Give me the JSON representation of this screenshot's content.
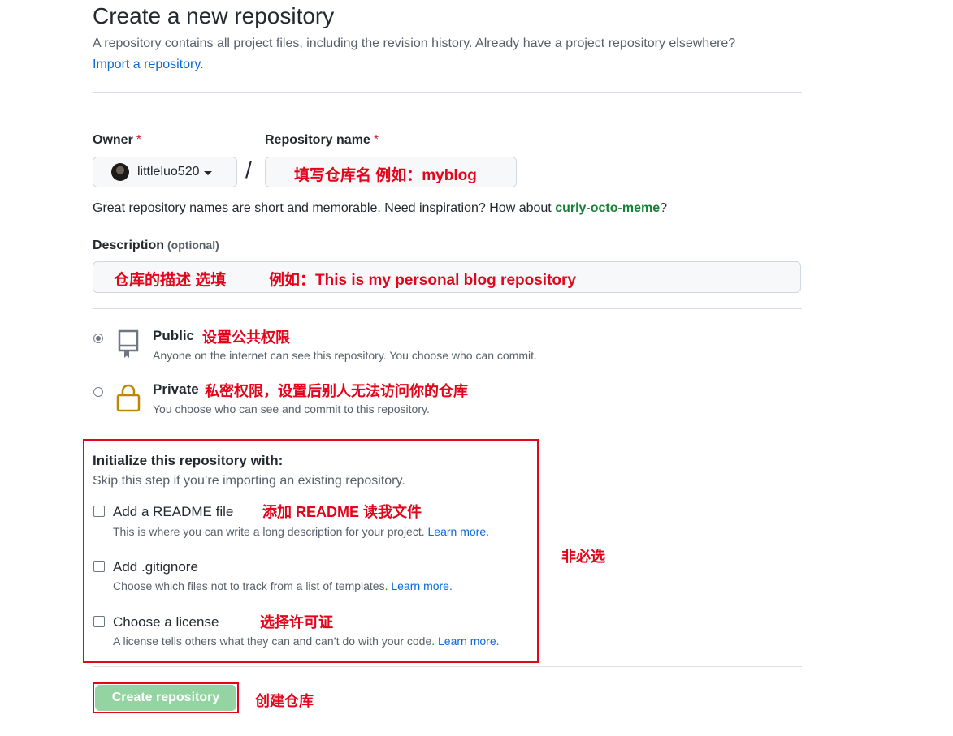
{
  "header": {
    "title": "Create a new repository",
    "subtitle": "A repository contains all project files, including the revision history. Already have a project repository elsewhere?",
    "import_link": "Import a repository."
  },
  "owner": {
    "label": "Owner",
    "required_mark": "*",
    "value": "littleluo520"
  },
  "repo_name": {
    "label": "Repository name",
    "required_mark": "*",
    "slash": "/",
    "annotation": "填写仓库名   例如：myblog"
  },
  "name_hint": {
    "text": "Great repository names are short and memorable. Need inspiration? How about ",
    "suggestion": "curly-octo-meme",
    "end": "?"
  },
  "description": {
    "label": "Description",
    "optional": "(optional)",
    "annotation_left": "仓库的描述  选填",
    "annotation_right": "例如：This is my personal blog repository"
  },
  "visibility": {
    "public": {
      "title": "Public",
      "subtitle": "Anyone on the internet can see this repository. You choose who can commit.",
      "annotation": "设置公共权限",
      "checked": true
    },
    "private": {
      "title": "Private",
      "subtitle": "You choose who can see and commit to this repository.",
      "annotation": "私密权限，设置后别人无法访问你的仓库",
      "checked": false
    }
  },
  "initialize": {
    "title": "Initialize this repository with:",
    "subtitle": "Skip this step if you’re importing an existing repository.",
    "side_annotation": "非必选",
    "options": [
      {
        "title": "Add a README file",
        "subtitle": "This is where you can write a long description for your project.",
        "link": "Learn more.",
        "annotation": "添加 README 读我文件"
      },
      {
        "title": "Add .gitignore",
        "subtitle": "Choose which files not to track from a list of templates.",
        "link": "Learn more."
      },
      {
        "title": "Choose a license",
        "subtitle": "A license tells others what they can and can’t do with your code.",
        "link": "Learn more.",
        "annotation": "选择许可证"
      }
    ]
  },
  "submit": {
    "label": "Create repository",
    "annotation": "创建仓库"
  },
  "colors": {
    "annotation_red": "#e3051b",
    "link_blue": "#0969da",
    "suggest_green": "#1a7f37",
    "button_green_disabled": "#94d3a2"
  },
  "icons": {
    "repo": "repo-icon",
    "lock": "lock-icon"
  }
}
